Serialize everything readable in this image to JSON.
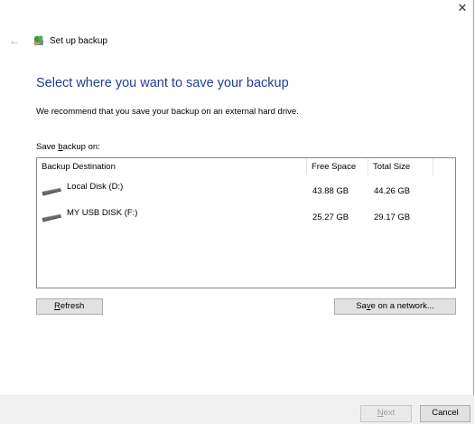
{
  "window": {
    "close_glyph": "✕",
    "back_glyph": "←",
    "title": "Set up backup"
  },
  "main": {
    "heading": "Select where you want to save your backup",
    "description": "We recommend that you save your backup on an external hard drive.",
    "save_label_pre": "Save ",
    "save_label_accel": "b",
    "save_label_post": "ackup on:"
  },
  "table": {
    "columns": [
      "Backup Destination",
      "Free Space",
      "Total Size"
    ],
    "rows": [
      {
        "name": "Local Disk (D:)",
        "free": "43.88 GB",
        "total": "44.26 GB",
        "icon": "drive-icon"
      },
      {
        "name": "MY USB DISK (F:)",
        "free": "25.27 GB",
        "total": "29.17 GB",
        "icon": "drive-icon"
      }
    ]
  },
  "buttons": {
    "refresh_accel": "R",
    "refresh_rest": "efresh",
    "network_pre": "Sa",
    "network_accel": "v",
    "network_post": "e on a network...",
    "next_accel": "N",
    "next_rest": "ext",
    "cancel": "Cancel"
  },
  "colors": {
    "heading": "#1f3f95",
    "footer_bg": "#f0f0f0",
    "button_bg": "#e1e1e1"
  }
}
